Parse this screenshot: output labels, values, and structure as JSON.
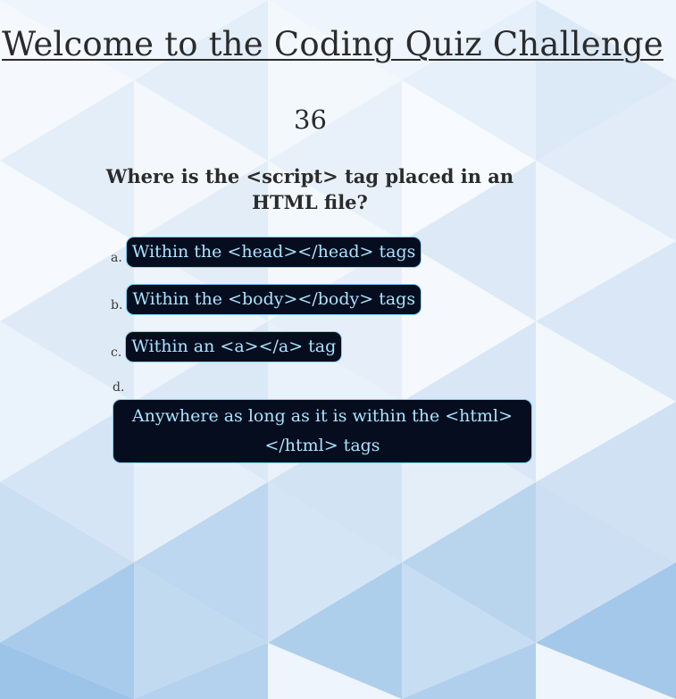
{
  "header": {
    "title": "Welcome to the Coding Quiz Challenge"
  },
  "quiz": {
    "timer": "36",
    "question": "Where is the <script> tag placed in an HTML file?",
    "choices": [
      {
        "letter": "a.",
        "text": "Within the <head></head> tags"
      },
      {
        "letter": "b.",
        "text": "Within the <body></body> tags"
      },
      {
        "letter": "c.",
        "text": "Within an <a></a> tag"
      },
      {
        "letter": "d.",
        "text": "Anywhere as long as it is within the <html></html> tags"
      }
    ]
  },
  "colors": {
    "button_bg": "#050d1e",
    "button_text": "#a9e4ff",
    "button_border": "#7fd0f5",
    "background": "#eaf3fb"
  },
  "background_pattern": "blue-triangle-mosaic"
}
